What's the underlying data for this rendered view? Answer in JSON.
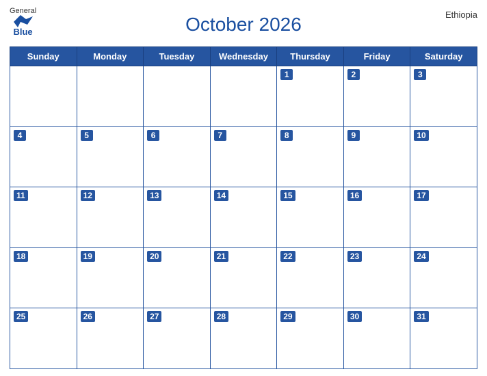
{
  "header": {
    "title": "October 2026",
    "country": "Ethiopia",
    "logo": {
      "general": "General",
      "blue": "Blue"
    }
  },
  "weekdays": [
    "Sunday",
    "Monday",
    "Tuesday",
    "Wednesday",
    "Thursday",
    "Friday",
    "Saturday"
  ],
  "weeks": [
    [
      null,
      null,
      null,
      null,
      1,
      2,
      3
    ],
    [
      4,
      5,
      6,
      7,
      8,
      9,
      10
    ],
    [
      11,
      12,
      13,
      14,
      15,
      16,
      17
    ],
    [
      18,
      19,
      20,
      21,
      22,
      23,
      24
    ],
    [
      25,
      26,
      27,
      28,
      29,
      30,
      31
    ]
  ]
}
